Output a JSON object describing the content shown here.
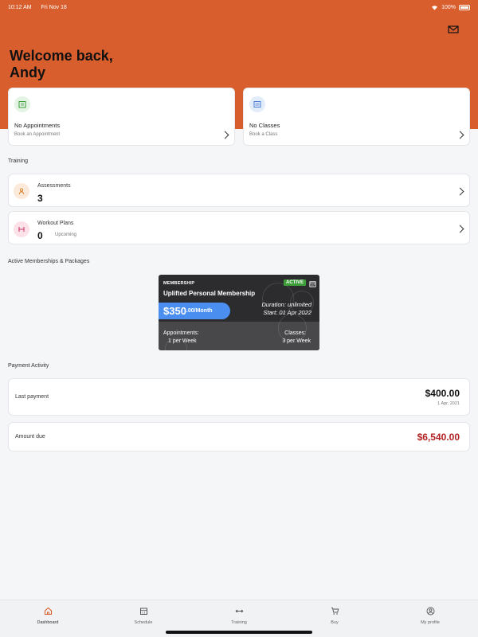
{
  "status_bar": {
    "time": "10:12 AM",
    "date": "Fri Nov 18",
    "battery": "100%"
  },
  "header": {
    "welcome_line1": "Welcome back,",
    "welcome_line2": "Andy",
    "mail_icon": "mail-icon"
  },
  "quick_cards": [
    {
      "title": "No Appointments",
      "subtitle": "Book an Appointment",
      "icon": "calendar-icon"
    },
    {
      "title": "No Classes",
      "subtitle": "Book a Class",
      "icon": "classes-icon"
    }
  ],
  "training": {
    "section_title": "Training",
    "items": [
      {
        "title": "Assessments",
        "value": "3",
        "sub": "",
        "icon": "assessment-icon"
      },
      {
        "title": "Workout Plans",
        "value": "0",
        "sub": "Upcoming",
        "icon": "dumbbell-icon"
      }
    ]
  },
  "memberships": {
    "section_title": "Active Memberships & Packages",
    "card": {
      "label": "MEMBERSHIP",
      "name": "Uplifted Personal Membership",
      "status": "ACTIVE",
      "price_main": "$350",
      "price_suffix": ".00/Month",
      "duration": "Duration: unlimited",
      "start": "Start: 01 Apr 2022",
      "appointments_label": "Appointments:",
      "appointments_value": "1 per Week",
      "classes_label": "Classes:",
      "classes_value": "3 per Week"
    }
  },
  "payment": {
    "section_title": "Payment Activity",
    "last_label": "Last payment",
    "last_amount": "$400.00",
    "last_date": "1 Apr, 2021",
    "due_label": "Amount due",
    "due_amount": "$6,540.00"
  },
  "tabs": [
    {
      "label": "Dashboard",
      "icon": "home-icon",
      "active": true
    },
    {
      "label": "Schedule",
      "icon": "calendar-icon",
      "active": false
    },
    {
      "label": "Training",
      "icon": "arrows-icon",
      "active": false
    },
    {
      "label": "Buy",
      "icon": "cart-icon",
      "active": false
    },
    {
      "label": "My profile",
      "icon": "profile-icon",
      "active": false
    }
  ],
  "colors": {
    "header": "#d95e2d",
    "accent_blue": "#4a8ff0",
    "active_green": "#3c9d39",
    "due_red": "#b22222"
  }
}
